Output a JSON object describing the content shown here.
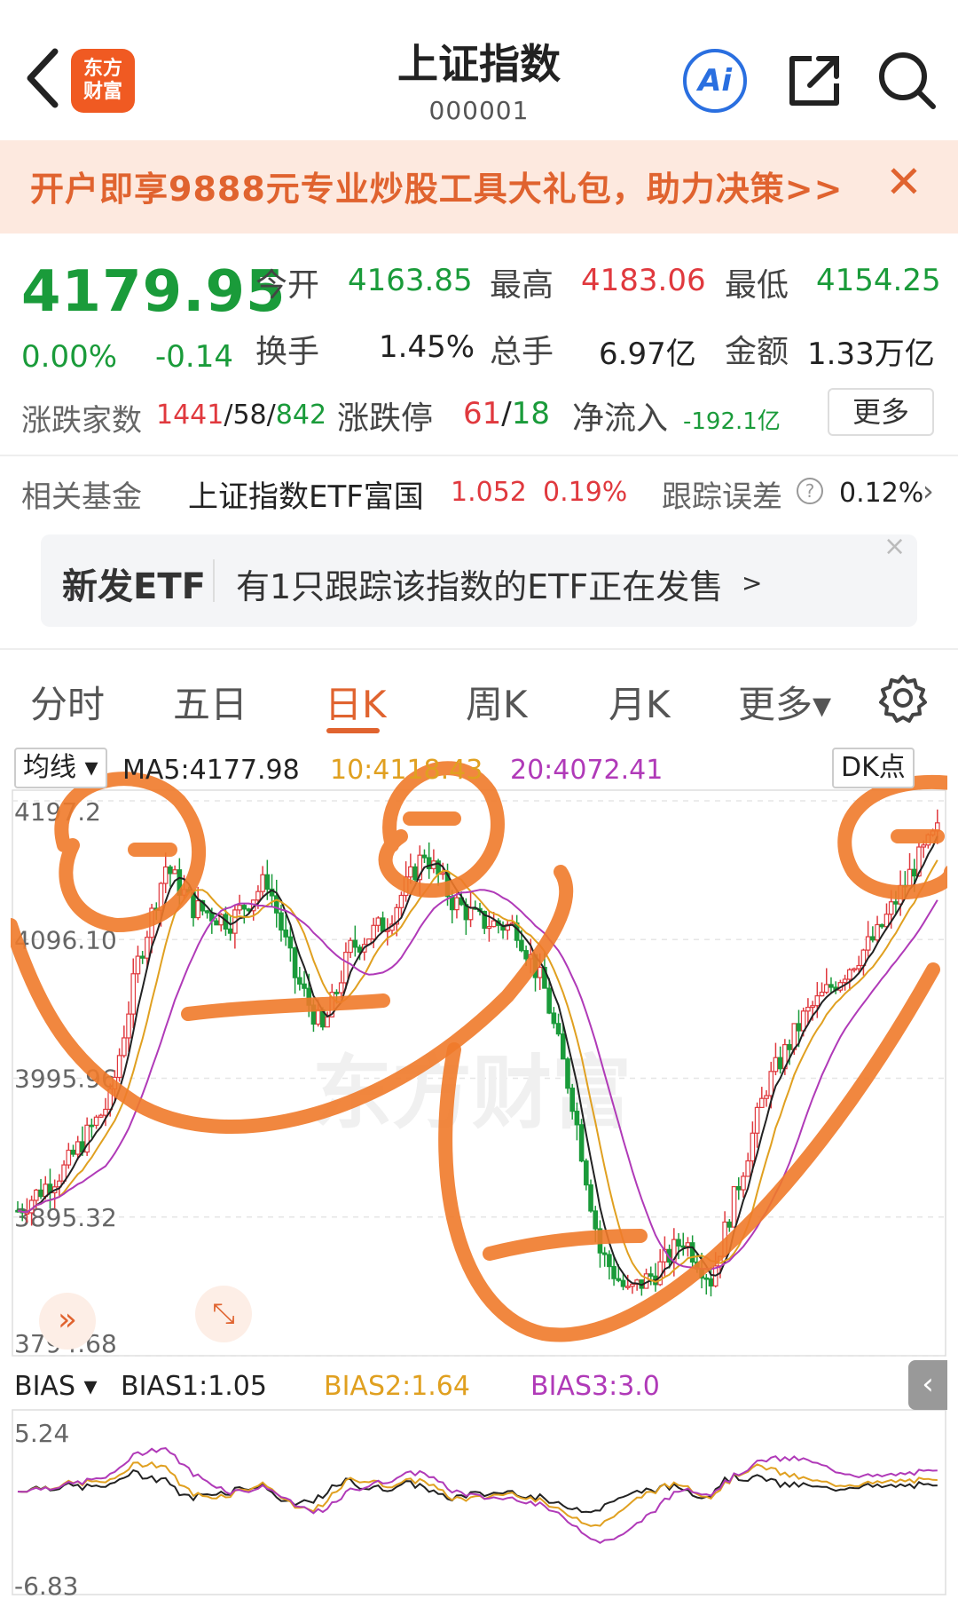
{
  "header": {
    "title": "上证指数",
    "code": "000001",
    "logo_line1": "东方",
    "logo_line2": "财富",
    "ai_label": "Ai",
    "icons": [
      "back-arrow-icon",
      "ai-icon",
      "share-icon",
      "search-icon"
    ]
  },
  "banner": {
    "text": "开户即享9888元专业炒股工具大礼包，助力决策>>",
    "close": "✕"
  },
  "quote": {
    "price": "4179.95",
    "change_pct": "0.00%",
    "change": "-0.14",
    "open_label": "今开",
    "open": "4163.85",
    "high_label": "最高",
    "high": "4183.06",
    "low_label": "最低",
    "low": "4154.25",
    "turnover_label": "换手",
    "turnover": "1.45%",
    "volume_label": "总手",
    "volume": "6.97亿",
    "amount_label": "金额",
    "amount": "1.33万亿",
    "breadth_label": "涨跌家数",
    "breadth_up": "1441",
    "breadth_flat": "58",
    "breadth_down": "842",
    "limit_label": "涨跌停",
    "limit_up": "61",
    "limit_down": "18",
    "netflow_label": "净流入",
    "netflow": "-192.1亿",
    "more_button": "更多"
  },
  "fund": {
    "label": "相关基金",
    "name": "上证指数ETF富国",
    "price": "1.052",
    "pct": "0.19%",
    "track_label": "跟踪误差",
    "track_value": "0.12%"
  },
  "new_etf": {
    "tag": "新发ETF",
    "text": "有1只跟踪该指数的ETF正在发售",
    "arrow": ">",
    "close": "×"
  },
  "tabs": [
    "分时",
    "五日",
    "日K",
    "周K",
    "月K",
    "更多▾"
  ],
  "active_tab": "日K",
  "ma_bar": {
    "selector": "均线",
    "ma5": "MA5:4177.98",
    "ma10": "10:4118.43",
    "ma20": "20:4072.41",
    "dk": "DK点"
  },
  "chart_data": {
    "type": "candlestick",
    "y_ticks": [
      "4197.2",
      "4096.10",
      "3995.96",
      "3895.32",
      "3794.68"
    ],
    "ylim": [
      3794.68,
      4197.2
    ],
    "watermark": "东方财富",
    "colors": {
      "up": "#e0393e",
      "down": "#1a9b3a",
      "ma5": "#222222",
      "ma10": "#e0a020",
      "ma20": "#b03ab8",
      "annotation": "#f07a2a"
    }
  },
  "bias": {
    "selector": "BIAS",
    "bias1": "BIAS1:1.05",
    "bias2": "BIAS2:1.64",
    "bias3": "BIAS3:3.0",
    "ylim_top": "5.24",
    "ylim_bottom": "-6.83"
  }
}
